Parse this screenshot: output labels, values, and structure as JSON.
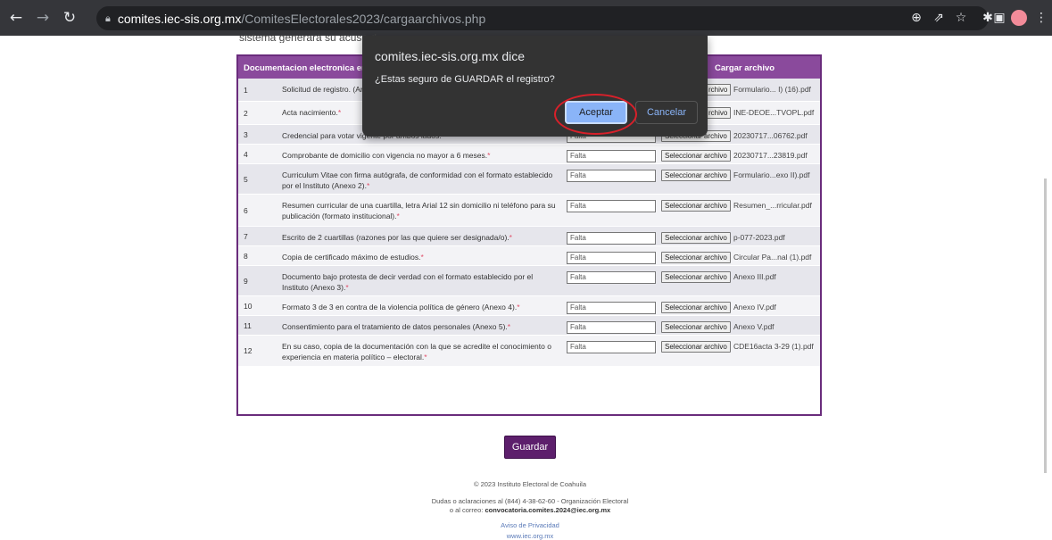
{
  "browser": {
    "url_host": "comites.iec-sis.org.mx",
    "url_path": "/ComitesElectorales2023/cargaarchivos.php",
    "icons": [
      "back-icon",
      "forward-icon",
      "reload-icon",
      "lock-icon",
      "zoom-icon",
      "share-icon",
      "star-icon",
      "extensions-icon",
      "sidepanel-icon",
      "profile-avatar",
      "menu-icon"
    ]
  },
  "page": {
    "cut_text": "sistema generará su acuse d",
    "table": {
      "header_doc": "Documentacion electronica en form",
      "header_upload": "Cargar archivo",
      "button_label": "Seleccionar archivo",
      "rows": [
        {
          "num": "1",
          "desc": "Solicitud de registro. (An",
          "status": "",
          "file": "Formulario... I) (16).pdf",
          "btn": "rchivo"
        },
        {
          "num": "2",
          "desc": "Acta nacimiento.",
          "status": "",
          "file": "INE-DEOE...TVOPL.pdf",
          "btn": "rchivo"
        },
        {
          "num": "3",
          "desc": "Credencial para votar vigente por ambos lados.",
          "status": "Falta",
          "file": "20230717...06762.pdf",
          "btn": "Seleccionar archivo"
        },
        {
          "num": "4",
          "desc": "Comprobante de domicilio con vigencia no mayor a 6 meses.",
          "status": "Falta",
          "file": "20230717...23819.pdf",
          "btn": "Seleccionar archivo"
        },
        {
          "num": "5",
          "desc": "Curriculum Vitae con firma autógrafa, de conformidad con el formato establecido por el Instituto (Anexo 2).",
          "status": "Falta",
          "file": "Formulario...exo II).pdf",
          "btn": "Seleccionar archivo"
        },
        {
          "num": "6",
          "desc": "Resumen curricular de una cuartilla, letra Arial 12 sin domicilio ni teléfono para su publicación (formato institucional).",
          "status": "Falta",
          "file": "Resumen_...rricular.pdf",
          "btn": "Seleccionar archivo"
        },
        {
          "num": "7",
          "desc": "Escrito de 2 cuartillas (razones por las que quiere ser designada/o).",
          "status": "Falta",
          "file": "p-077-2023.pdf",
          "btn": "Seleccionar archivo"
        },
        {
          "num": "8",
          "desc": "Copia de certificado máximo de estudios.",
          "status": "Falta",
          "file": "Circular Pa...nal (1).pdf",
          "btn": "Seleccionar archivo"
        },
        {
          "num": "9",
          "desc": "Documento bajo protesta de decir verdad con el formato establecido por el Instituto (Anexo 3).",
          "status": "Falta",
          "file": "Anexo III.pdf",
          "btn": "Seleccionar archivo"
        },
        {
          "num": "10",
          "desc": "Formato 3 de 3 en contra de la violencia política de género (Anexo 4).",
          "status": "Falta",
          "file": "Anexo IV.pdf",
          "btn": "Seleccionar archivo"
        },
        {
          "num": "11",
          "desc": "Consentimiento para el tratamiento de datos personales (Anexo 5).",
          "status": "Falta",
          "file": "Anexo V.pdf",
          "btn": "Seleccionar archivo"
        },
        {
          "num": "12",
          "desc": "En su caso, copia de la documentación con la que se acredite el conocimiento o experiencia en materia político – electoral.",
          "status": "Falta",
          "file": "CDE16acta 3-29 (1).pdf",
          "btn": "Seleccionar archivo"
        }
      ]
    },
    "save_label": "Guardar",
    "footer": {
      "copyright": "© 2023 Instituto Electoral de Coahuila",
      "contact": "Dudas o aclaraciones al (844) 4-38-62-60 - Organización Electoral",
      "email_prefix": "o al correo:",
      "email": "convocatoria.comites.2024@iec.org.mx",
      "privacy": "Aviso de Privacidad",
      "site": "www.iec.org.mx"
    }
  },
  "dialog": {
    "title": "comites.iec-sis.org.mx dice",
    "message": "¿Estas seguro de GUARDAR el registro?",
    "ok_label": "Aceptar",
    "cancel_label": "Cancelar"
  },
  "colors": {
    "accent": "#8ab4f8",
    "table_header": "#8a4a9c",
    "highlight_circle": "#d8202a"
  }
}
